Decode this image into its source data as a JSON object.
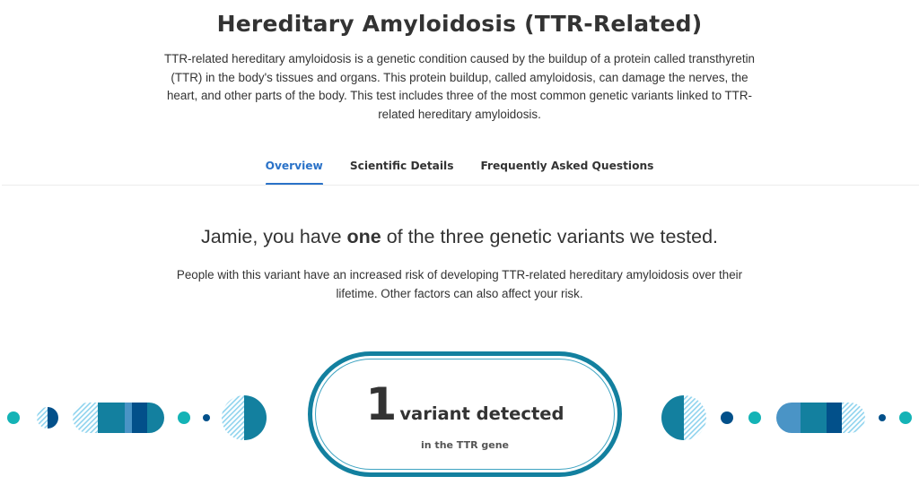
{
  "header": {
    "title": "Hereditary Amyloidosis (TTR-Related)",
    "intro": "TTR-related hereditary amyloidosis is a genetic condition caused by the buildup of a protein called transthyretin (TTR) in the body's tissues and organs. This protein buildup, called amyloidosis, can damage the nerves, the heart, and other parts of the body. This test includes three of the most common genetic variants linked to TTR-related hereditary amyloidosis."
  },
  "tabs": [
    {
      "label": "Overview",
      "active": true
    },
    {
      "label": "Scientific Details",
      "active": false
    },
    {
      "label": "Frequently Asked Questions",
      "active": false
    }
  ],
  "result": {
    "headline_prefix": "Jamie, you have ",
    "headline_bold": "one",
    "headline_suffix": " of the three genetic variants we tested.",
    "description": "People with this variant have an increased risk of developing TTR-related hereditary amyloidosis over their lifetime. Other factors can also affect your risk.",
    "variant_count": "1",
    "variant_label": "variant detected",
    "gene_label": "in the TTR gene"
  },
  "colors": {
    "accent_tab": "#2a72c8",
    "teal": "#13809f",
    "dark_blue": "#02508a",
    "mid_blue": "#4a94c6",
    "turquoise": "#14b3b6",
    "hatch": "#8fd3ee"
  }
}
